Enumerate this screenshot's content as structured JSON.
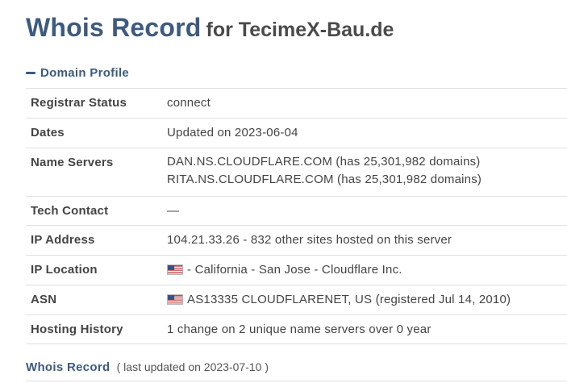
{
  "header": {
    "title": "Whois Record",
    "subtitle": "for TecimeX-Bau.de"
  },
  "section": {
    "label": "Domain Profile",
    "toggle_icon": "minus-icon"
  },
  "profile": {
    "registrar_status": {
      "label": "Registrar Status",
      "value": "connect"
    },
    "dates": {
      "label": "Dates",
      "value": "Updated on 2023-06-04"
    },
    "name_servers": {
      "label": "Name Servers",
      "values": [
        "DAN.NS.CLOUDFLARE.COM (has 25,301,982 domains)",
        "RITA.NS.CLOUDFLARE.COM (has 25,301,982 domains)"
      ]
    },
    "tech_contact": {
      "label": "Tech Contact",
      "value": "—"
    },
    "ip_address": {
      "label": "IP Address",
      "value": "104.21.33.26 - 832 other sites hosted on this server"
    },
    "ip_location": {
      "label": "IP Location",
      "value": "- California - San Jose - Cloudflare Inc.",
      "flag_icon": "us-flag-icon"
    },
    "asn": {
      "label": "ASN",
      "value": "AS13335 CLOUDFLARENET, US (registered Jul 14, 2010)",
      "flag_icon": "us-flag-icon"
    },
    "hosting_history": {
      "label": "Hosting History",
      "value": "1 change on 2 unique name servers over 0 year"
    }
  },
  "footer": {
    "title": "Whois Record",
    "updated": "( last updated on 2023-07-10 )"
  },
  "colors": {
    "accent": "#3d5a80",
    "text": "#444444",
    "border": "#e0e0e0"
  }
}
